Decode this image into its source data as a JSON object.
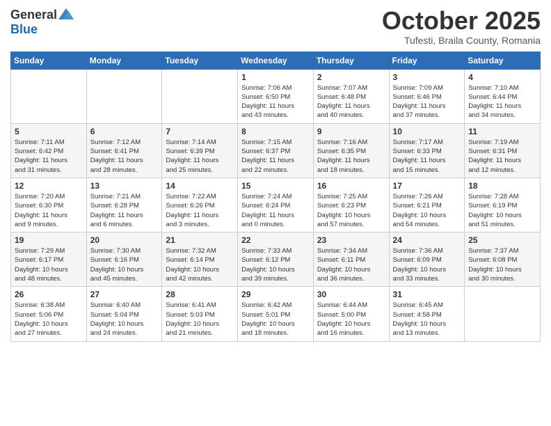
{
  "header": {
    "logo_general": "General",
    "logo_blue": "Blue",
    "month": "October 2025",
    "location": "Tufesti, Braila County, Romania"
  },
  "weekdays": [
    "Sunday",
    "Monday",
    "Tuesday",
    "Wednesday",
    "Thursday",
    "Friday",
    "Saturday"
  ],
  "weeks": [
    [
      {
        "day": "",
        "info": ""
      },
      {
        "day": "",
        "info": ""
      },
      {
        "day": "",
        "info": ""
      },
      {
        "day": "1",
        "info": "Sunrise: 7:06 AM\nSunset: 6:50 PM\nDaylight: 11 hours\nand 43 minutes."
      },
      {
        "day": "2",
        "info": "Sunrise: 7:07 AM\nSunset: 6:48 PM\nDaylight: 11 hours\nand 40 minutes."
      },
      {
        "day": "3",
        "info": "Sunrise: 7:09 AM\nSunset: 6:46 PM\nDaylight: 11 hours\nand 37 minutes."
      },
      {
        "day": "4",
        "info": "Sunrise: 7:10 AM\nSunset: 6:44 PM\nDaylight: 11 hours\nand 34 minutes."
      }
    ],
    [
      {
        "day": "5",
        "info": "Sunrise: 7:11 AM\nSunset: 6:42 PM\nDaylight: 11 hours\nand 31 minutes."
      },
      {
        "day": "6",
        "info": "Sunrise: 7:12 AM\nSunset: 6:41 PM\nDaylight: 11 hours\nand 28 minutes."
      },
      {
        "day": "7",
        "info": "Sunrise: 7:14 AM\nSunset: 6:39 PM\nDaylight: 11 hours\nand 25 minutes."
      },
      {
        "day": "8",
        "info": "Sunrise: 7:15 AM\nSunset: 6:37 PM\nDaylight: 11 hours\nand 22 minutes."
      },
      {
        "day": "9",
        "info": "Sunrise: 7:16 AM\nSunset: 6:35 PM\nDaylight: 11 hours\nand 18 minutes."
      },
      {
        "day": "10",
        "info": "Sunrise: 7:17 AM\nSunset: 6:33 PM\nDaylight: 11 hours\nand 15 minutes."
      },
      {
        "day": "11",
        "info": "Sunrise: 7:19 AM\nSunset: 6:31 PM\nDaylight: 11 hours\nand 12 minutes."
      }
    ],
    [
      {
        "day": "12",
        "info": "Sunrise: 7:20 AM\nSunset: 6:30 PM\nDaylight: 11 hours\nand 9 minutes."
      },
      {
        "day": "13",
        "info": "Sunrise: 7:21 AM\nSunset: 6:28 PM\nDaylight: 11 hours\nand 6 minutes."
      },
      {
        "day": "14",
        "info": "Sunrise: 7:22 AM\nSunset: 6:26 PM\nDaylight: 11 hours\nand 3 minutes."
      },
      {
        "day": "15",
        "info": "Sunrise: 7:24 AM\nSunset: 6:24 PM\nDaylight: 11 hours\nand 0 minutes."
      },
      {
        "day": "16",
        "info": "Sunrise: 7:25 AM\nSunset: 6:23 PM\nDaylight: 10 hours\nand 57 minutes."
      },
      {
        "day": "17",
        "info": "Sunrise: 7:26 AM\nSunset: 6:21 PM\nDaylight: 10 hours\nand 54 minutes."
      },
      {
        "day": "18",
        "info": "Sunrise: 7:28 AM\nSunset: 6:19 PM\nDaylight: 10 hours\nand 51 minutes."
      }
    ],
    [
      {
        "day": "19",
        "info": "Sunrise: 7:29 AM\nSunset: 6:17 PM\nDaylight: 10 hours\nand 48 minutes."
      },
      {
        "day": "20",
        "info": "Sunrise: 7:30 AM\nSunset: 6:16 PM\nDaylight: 10 hours\nand 45 minutes."
      },
      {
        "day": "21",
        "info": "Sunrise: 7:32 AM\nSunset: 6:14 PM\nDaylight: 10 hours\nand 42 minutes."
      },
      {
        "day": "22",
        "info": "Sunrise: 7:33 AM\nSunset: 6:12 PM\nDaylight: 10 hours\nand 39 minutes."
      },
      {
        "day": "23",
        "info": "Sunrise: 7:34 AM\nSunset: 6:11 PM\nDaylight: 10 hours\nand 36 minutes."
      },
      {
        "day": "24",
        "info": "Sunrise: 7:36 AM\nSunset: 6:09 PM\nDaylight: 10 hours\nand 33 minutes."
      },
      {
        "day": "25",
        "info": "Sunrise: 7:37 AM\nSunset: 6:08 PM\nDaylight: 10 hours\nand 30 minutes."
      }
    ],
    [
      {
        "day": "26",
        "info": "Sunrise: 6:38 AM\nSunset: 5:06 PM\nDaylight: 10 hours\nand 27 minutes."
      },
      {
        "day": "27",
        "info": "Sunrise: 6:40 AM\nSunset: 5:04 PM\nDaylight: 10 hours\nand 24 minutes."
      },
      {
        "day": "28",
        "info": "Sunrise: 6:41 AM\nSunset: 5:03 PM\nDaylight: 10 hours\nand 21 minutes."
      },
      {
        "day": "29",
        "info": "Sunrise: 6:42 AM\nSunset: 5:01 PM\nDaylight: 10 hours\nand 18 minutes."
      },
      {
        "day": "30",
        "info": "Sunrise: 6:44 AM\nSunset: 5:00 PM\nDaylight: 10 hours\nand 16 minutes."
      },
      {
        "day": "31",
        "info": "Sunrise: 6:45 AM\nSunset: 4:58 PM\nDaylight: 10 hours\nand 13 minutes."
      },
      {
        "day": "",
        "info": ""
      }
    ]
  ]
}
